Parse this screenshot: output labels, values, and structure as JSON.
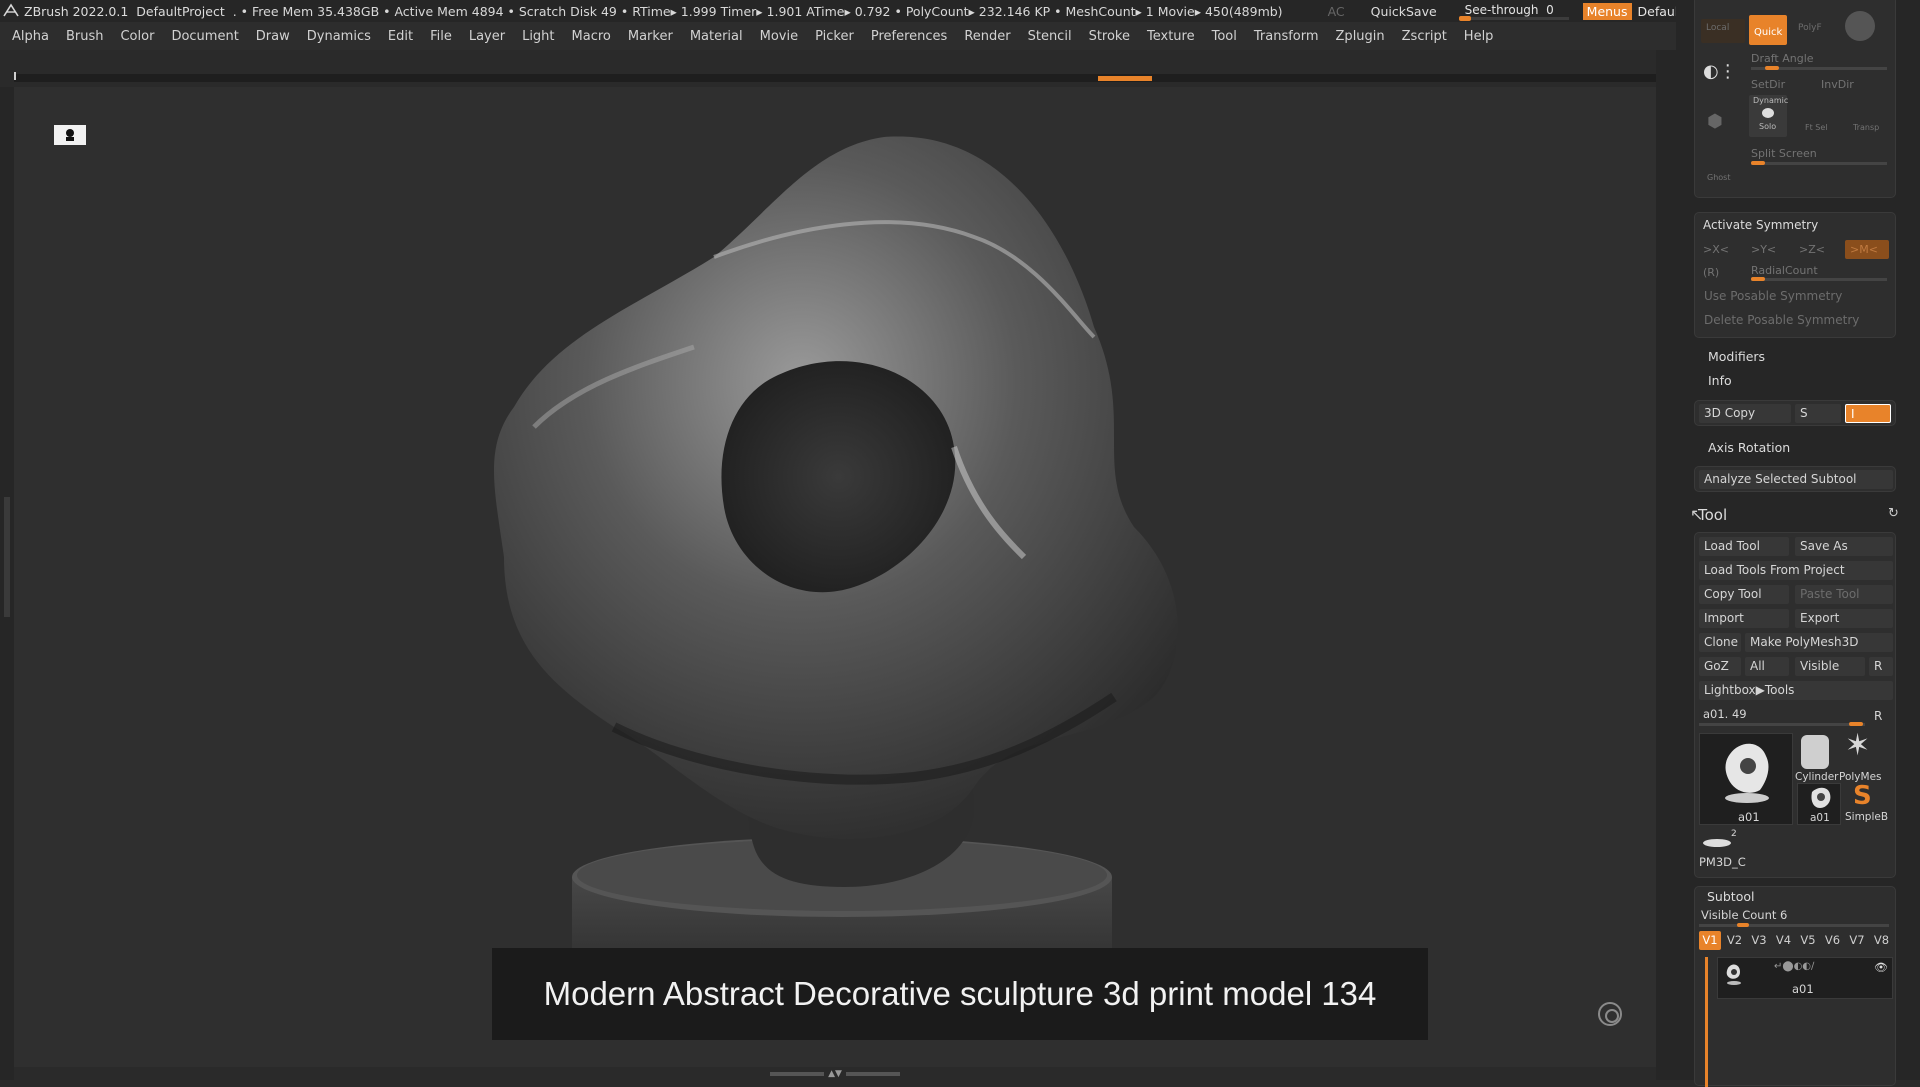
{
  "titlebar": {
    "app": "ZBrush 2022.0.1",
    "project": "DefaultProject",
    "stats": ". • Free Mem 35.438GB • Active Mem 4894 • Scratch Disk 49 •  RTime▸ 1.999 Timer▸ 1.901 ATime▸ 0.792 • PolyCount▸ 232.146 KP  • MeshCount▸ 1  Movie▸ 450(489mb)",
    "ac": "AC",
    "quicksave": "QuickSave",
    "see_through_label": "See-through",
    "see_through_value": "0",
    "see_through_level": 0.0,
    "menus": "Menus",
    "zscript": "DefaultZScript"
  },
  "menubar": [
    "Alpha",
    "Brush",
    "Color",
    "Document",
    "Draw",
    "Dynamics",
    "Edit",
    "File",
    "Layer",
    "Light",
    "Macro",
    "Marker",
    "Material",
    "Movie",
    "Picker",
    "Preferences",
    "Render",
    "Stencil",
    "Stroke",
    "Texture",
    "Tool",
    "Transform",
    "Zplugin",
    "Zscript",
    "Help"
  ],
  "canvas": {
    "caption": "Modern Abstract Decorative sculpture 3d print model 134"
  },
  "tray": {
    "top": {
      "local": "Local",
      "quick": "Quick",
      "polyf": "PolyF",
      "draft_angle": "Draft Angle",
      "setdir": "SetDir",
      "invdir": "InvDir",
      "dynamic": "Dynamic",
      "solo": "Solo",
      "ftsel": "Ft Sel",
      "transp": "Transp",
      "ghost": "Ghost",
      "split_screen": "Split Screen"
    },
    "symmetry": {
      "activate": "Activate Symmetry",
      "x": ">X<",
      "y": ">Y<",
      "z": ">Z<",
      "m": ">M<",
      "r": "(R)",
      "radial": "RadialCount",
      "use_posable": "Use Posable Symmetry",
      "delete_posable": "Delete Posable Symmetry"
    },
    "modifiers": "Modifiers",
    "info": "Info",
    "copy3d": "3D Copy",
    "copy3d_s": "S",
    "copy3d_i": "I",
    "axis_rotation": "Axis Rotation",
    "analyze": "Analyze Selected Subtool",
    "tool": {
      "title": "Tool",
      "load_tool": "Load Tool",
      "save_as": "Save As",
      "load_from_project": "Load Tools From Project",
      "copy_tool": "Copy Tool",
      "paste_tool": "Paste Tool",
      "import": "Import",
      "export": "Export",
      "clone": "Clone",
      "make_polymesh": "Make PolyMesh3D",
      "goz": "GoZ",
      "all": "All",
      "visible": "Visible",
      "r": "R",
      "lightbox": "Lightbox▶Tools",
      "current_tool": "a01. 49",
      "current_r": "R",
      "thumbs": {
        "main": "a01",
        "cylinder": "Cylinder",
        "polymesh": "PolyMes",
        "small_a01": "a01",
        "simpleb": "SimpleB",
        "pm3d": "PM3D_C",
        "pm3d_count": "2"
      }
    },
    "subtool": {
      "title": "Subtool",
      "visible_count": "Visible Count 6",
      "tabs": [
        "V1",
        "V2",
        "V3",
        "V4",
        "V5",
        "V6",
        "V7",
        "V8"
      ],
      "item": "a01"
    }
  },
  "colors": {
    "accent": "#e8832a",
    "background": "#2f2f2f",
    "panel": "#2e2e2e"
  }
}
